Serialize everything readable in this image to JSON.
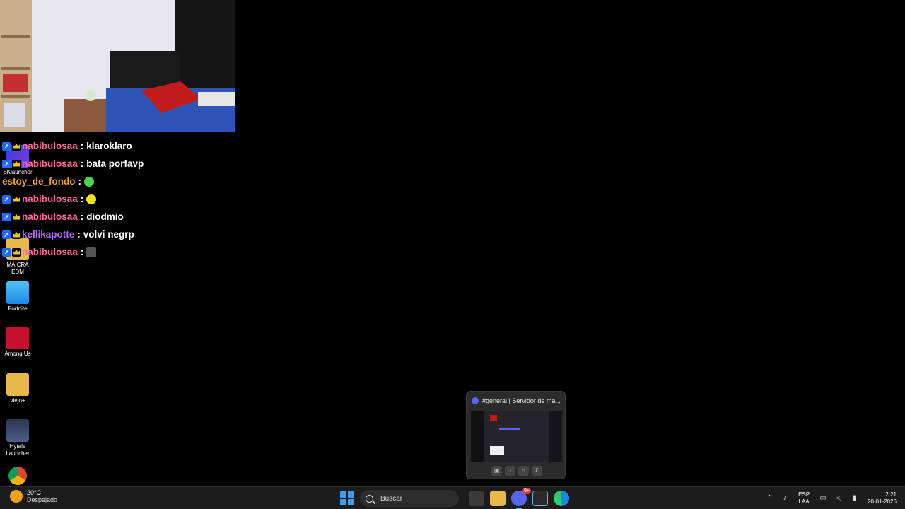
{
  "chat": [
    {
      "user": "nabibulosaa",
      "color": "#ff6b9e",
      "badges": [
        "vip",
        "crown"
      ],
      "message": "klaroklaro",
      "emote": null
    },
    {
      "user": "nabibulosaa",
      "color": "#ff6b9e",
      "badges": [
        "vip",
        "crown"
      ],
      "message": "bata porfavp",
      "emote": null
    },
    {
      "user": "estoy_de_fondo",
      "color": "#f0a020",
      "badges": [],
      "message": "",
      "emote": "green-blob-emote"
    },
    {
      "user": "nabibulosaa",
      "color": "#ff6b9e",
      "badges": [
        "vip",
        "crown"
      ],
      "message": "",
      "emote": "yellow-face-emote"
    },
    {
      "user": "nabibulosaa",
      "color": "#ff6b9e",
      "badges": [
        "vip",
        "crown"
      ],
      "message": "diodmio",
      "emote": null
    },
    {
      "user": "kellikapotte",
      "color": "#b26bff",
      "badges": [
        "vip",
        "crown"
      ],
      "message": "volvi negrp",
      "emote": null
    },
    {
      "user": "nabibulosaa",
      "color": "#ff6b9e",
      "badges": [
        "vip",
        "crown"
      ],
      "message": "",
      "emote": "photo-emote"
    }
  ],
  "chat_separator": ":",
  "desktop_icons": [
    {
      "label": "SKlauncher",
      "icon": "sklauncher-icon"
    },
    {
      "label": "MAICRA EDM",
      "icon": "folder-icon"
    },
    {
      "label": "Fortnite",
      "icon": "fortnite-icon"
    },
    {
      "label": "Among Us",
      "icon": "among-us-icon"
    },
    {
      "label": "viejo+",
      "icon": "folder-icon"
    },
    {
      "label": "Hytale Launcher",
      "icon": "hytale-icon"
    },
    {
      "label": "",
      "icon": "chrome-icon"
    }
  ],
  "preview": {
    "title": "#general | Servidor de ma...",
    "controls": [
      "camera-icon",
      "mic-icon",
      "headphones-icon",
      "end-call-icon"
    ]
  },
  "taskbar": {
    "weather_temp": "20°C",
    "weather_condition": "Despejado",
    "search_placeholder": "Buscar",
    "discord_badge": "9+",
    "lang_primary": "ESP",
    "lang_secondary": "LAA",
    "time": "2:21",
    "date": "20-01-2026"
  },
  "colors": {
    "taskbar_bg": "#1c1c1c",
    "accent": "#3aa0f3",
    "discord": "#5865f2"
  }
}
